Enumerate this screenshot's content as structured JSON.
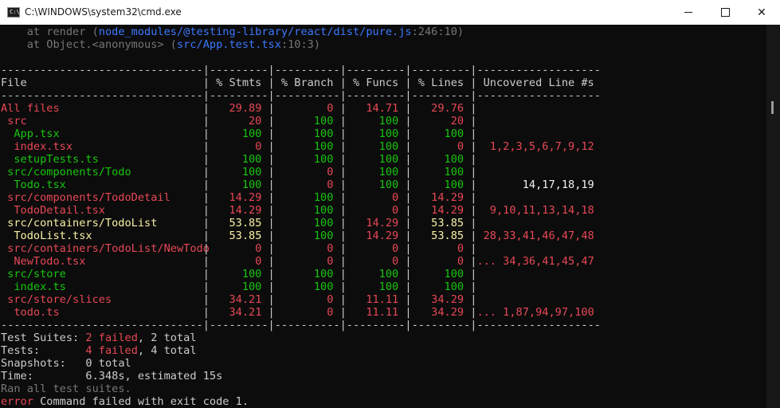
{
  "window": {
    "title": "C:\\WINDOWS\\system32\\cmd.exe",
    "icon_label": "C:\\.",
    "icon_name": "cmd-icon",
    "controls": {
      "minimize": "minimize-icon",
      "maximize": "maximize-icon",
      "close": "close-icon",
      "close_glyph": "✕"
    }
  },
  "colors": {
    "background": "#0c0c0c",
    "text": "#cccccc",
    "fail": "#e74856",
    "pass": "#16c60c",
    "warn": "#f9f1a5",
    "link": "#3b78ff",
    "dim": "#767676"
  },
  "stack_trace": [
    {
      "prefix": "    at render (",
      "path": "node_modules/@testing-library/react/dist/pure.js",
      "loc": ":246:10",
      "suffix": ")"
    },
    {
      "prefix": "    at Object.<anonymous> (",
      "path": "src/App.test.tsx",
      "loc": ":10:3",
      "suffix": ")"
    }
  ],
  "coverage": {
    "separator": "-------------------------------|---------|----------|---------|---------|-------------------",
    "columns": [
      "File",
      "% Stmts",
      "% Branch",
      "% Funcs",
      "% Lines",
      "Uncovered Line #s"
    ],
    "rows": [
      {
        "file": "All files",
        "indent": 0,
        "stmts": "29.89",
        "branch": "0",
        "funcs": "14.71",
        "lines": "29.76",
        "uncovered": "",
        "c": [
          "red",
          "red",
          "red",
          "red",
          "red",
          "red"
        ]
      },
      {
        "file": "src",
        "indent": 1,
        "stmts": "20",
        "branch": "100",
        "funcs": "100",
        "lines": "20",
        "uncovered": "",
        "c": [
          "red",
          "red",
          "green",
          "green",
          "red",
          "red"
        ]
      },
      {
        "file": "App.tsx",
        "indent": 2,
        "stmts": "100",
        "branch": "100",
        "funcs": "100",
        "lines": "100",
        "uncovered": "",
        "c": [
          "green",
          "green",
          "green",
          "green",
          "green",
          "green"
        ]
      },
      {
        "file": "index.tsx",
        "indent": 2,
        "stmts": "0",
        "branch": "100",
        "funcs": "100",
        "lines": "0",
        "uncovered": "1,2,3,5,6,7,9,12",
        "c": [
          "red",
          "red",
          "green",
          "green",
          "red",
          "red"
        ]
      },
      {
        "file": "setupTests.ts",
        "indent": 2,
        "stmts": "100",
        "branch": "100",
        "funcs": "100",
        "lines": "100",
        "uncovered": "",
        "c": [
          "green",
          "green",
          "green",
          "green",
          "green",
          "green"
        ]
      },
      {
        "file": "src/components/Todo",
        "indent": 1,
        "stmts": "100",
        "branch": "0",
        "funcs": "100",
        "lines": "100",
        "uncovered": "",
        "c": [
          "green",
          "green",
          "red",
          "green",
          "green",
          "green"
        ]
      },
      {
        "file": "Todo.tsx",
        "indent": 2,
        "stmts": "100",
        "branch": "0",
        "funcs": "100",
        "lines": "100",
        "uncovered": "14,17,18,19",
        "c": [
          "green",
          "green",
          "red",
          "green",
          "green",
          "white"
        ]
      },
      {
        "file": "src/components/TodoDetail",
        "indent": 1,
        "stmts": "14.29",
        "branch": "100",
        "funcs": "0",
        "lines": "14.29",
        "uncovered": "",
        "c": [
          "red",
          "red",
          "green",
          "red",
          "red",
          "red"
        ]
      },
      {
        "file": "TodoDetail.tsx",
        "indent": 2,
        "stmts": "14.29",
        "branch": "100",
        "funcs": "0",
        "lines": "14.29",
        "uncovered": "9,10,11,13,14,18",
        "c": [
          "red",
          "red",
          "green",
          "red",
          "red",
          "red"
        ]
      },
      {
        "file": "src/containers/TodoList",
        "indent": 1,
        "stmts": "53.85",
        "branch": "100",
        "funcs": "14.29",
        "lines": "53.85",
        "uncovered": "",
        "c": [
          "yellow",
          "yellow",
          "green",
          "red",
          "yellow",
          "yellow"
        ]
      },
      {
        "file": "TodoList.tsx",
        "indent": 2,
        "stmts": "53.85",
        "branch": "100",
        "funcs": "14.29",
        "lines": "53.85",
        "uncovered": "28,33,41,46,47,48",
        "c": [
          "yellow",
          "yellow",
          "green",
          "red",
          "yellow",
          "red"
        ]
      },
      {
        "file": "src/containers/TodoList/NewTodo",
        "indent": 1,
        "stmts": "0",
        "branch": "0",
        "funcs": "0",
        "lines": "0",
        "uncovered": "",
        "c": [
          "red",
          "red",
          "red",
          "red",
          "red",
          "red"
        ]
      },
      {
        "file": "NewTodo.tsx",
        "indent": 2,
        "stmts": "0",
        "branch": "0",
        "funcs": "0",
        "lines": "0",
        "uncovered": "... 34,36,41,45,47",
        "c": [
          "red",
          "red",
          "red",
          "red",
          "red",
          "red"
        ]
      },
      {
        "file": "src/store",
        "indent": 1,
        "stmts": "100",
        "branch": "100",
        "funcs": "100",
        "lines": "100",
        "uncovered": "",
        "c": [
          "green",
          "green",
          "green",
          "green",
          "green",
          "green"
        ]
      },
      {
        "file": "index.ts",
        "indent": 2,
        "stmts": "100",
        "branch": "100",
        "funcs": "100",
        "lines": "100",
        "uncovered": "",
        "c": [
          "green",
          "green",
          "green",
          "green",
          "green",
          "green"
        ]
      },
      {
        "file": "src/store/slices",
        "indent": 1,
        "stmts": "34.21",
        "branch": "0",
        "funcs": "11.11",
        "lines": "34.29",
        "uncovered": "",
        "c": [
          "red",
          "red",
          "red",
          "red",
          "red",
          "red"
        ]
      },
      {
        "file": "todo.ts",
        "indent": 2,
        "stmts": "34.21",
        "branch": "0",
        "funcs": "11.11",
        "lines": "34.29",
        "uncovered": "... 1,87,94,97,100",
        "c": [
          "red",
          "red",
          "red",
          "red",
          "red",
          "red"
        ]
      }
    ]
  },
  "summary": {
    "suites_label": "Test Suites: ",
    "suites_failed": "2 failed",
    "suites_total": ", 2 total",
    "tests_label": "Tests:       ",
    "tests_failed": "4 failed",
    "tests_total": ", 4 total",
    "snapshots": "Snapshots:   0 total",
    "time": "Time:        6.348s, estimated 15s",
    "ran_all": "Ran all test suites.",
    "error_label": "error",
    "error_message": " Command failed with exit code 1."
  }
}
